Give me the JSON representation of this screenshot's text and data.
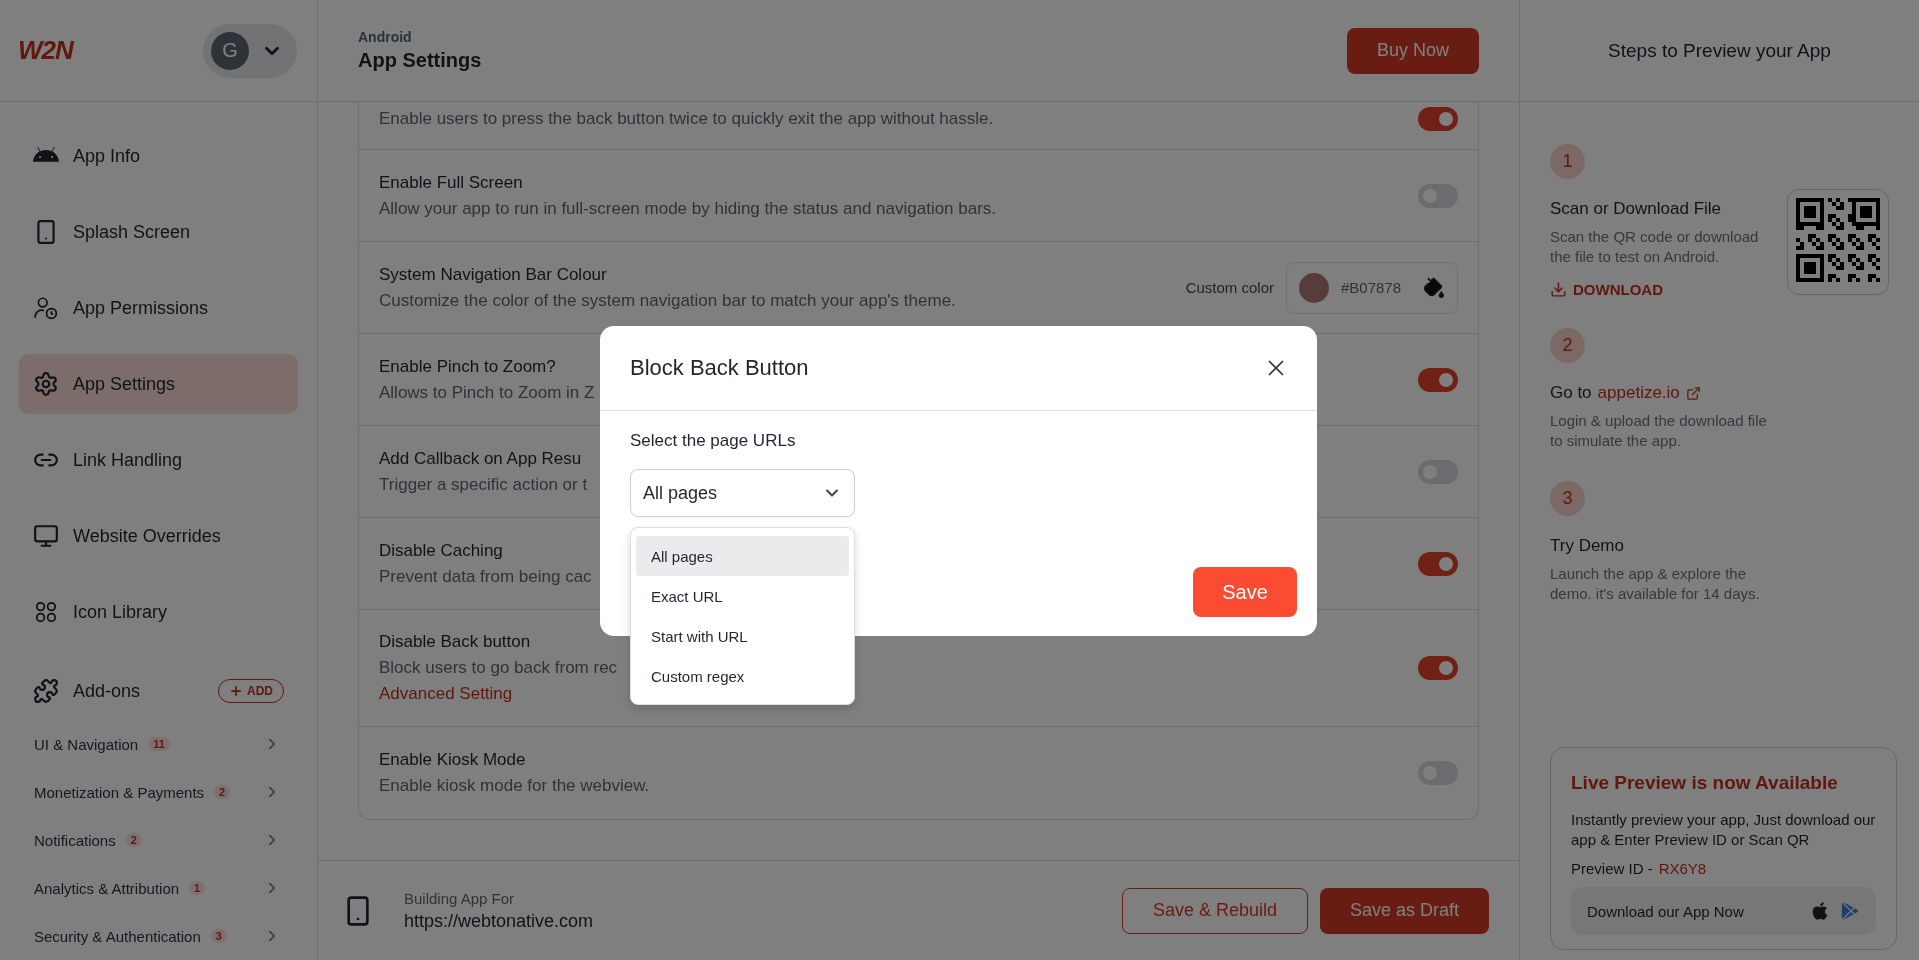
{
  "brand": {
    "logo": "W2N",
    "avatar": "G"
  },
  "sidebar": {
    "items": [
      {
        "label": "App Info",
        "selected": false
      },
      {
        "label": "Splash Screen",
        "selected": false
      },
      {
        "label": "App Permissions",
        "selected": false
      },
      {
        "label": "App Settings",
        "selected": true
      },
      {
        "label": "Link Handling",
        "selected": false
      },
      {
        "label": "Website Overrides",
        "selected": false
      },
      {
        "label": "Icon Library",
        "selected": false
      }
    ],
    "addons": {
      "label": "Add-ons",
      "button": "ADD"
    },
    "groups": [
      {
        "label": "UI & Navigation",
        "count": "11"
      },
      {
        "label": "Monetization & Payments",
        "count": "2"
      },
      {
        "label": "Notifications",
        "count": "2"
      },
      {
        "label": "Analytics & Attribution",
        "count": "1"
      },
      {
        "label": "Security & Authentication",
        "count": "3"
      }
    ]
  },
  "header": {
    "platform": "Android",
    "title": "App Settings",
    "button": "Buy Now"
  },
  "settings": [
    {
      "kind": "toggle",
      "description": "Enable users to press the back button twice to quickly exit the app without hassle.",
      "on": true
    },
    {
      "kind": "toggle",
      "title": "Enable Full Screen",
      "description": "Allow your app to run in full-screen mode by hiding the status and navigation bars.",
      "on": false
    },
    {
      "kind": "color",
      "title": "System Navigation Bar Colour",
      "description": "Customize the color of the system navigation bar to match your app's theme.",
      "color_label": "Custom color",
      "value": "#B07878"
    },
    {
      "kind": "toggle",
      "title": "Enable Pinch to Zoom?",
      "description": "Allows to Pinch to Zoom in Z",
      "on": true
    },
    {
      "kind": "toggle",
      "title": "Add Callback on App Resu",
      "description": "Trigger a specific action or t",
      "on": false
    },
    {
      "kind": "toggle",
      "title": "Disable Caching",
      "description": "Prevent data from being cac",
      "on": true
    },
    {
      "kind": "toggle",
      "title": "Disable Back button",
      "description": "Block users to go back from rec",
      "link": "Advanced Setting",
      "on": true
    },
    {
      "kind": "toggle",
      "title": "Enable Kiosk Mode",
      "description": "Enable kiosk mode for the webview.",
      "on": false
    }
  ],
  "footer": {
    "label": "Building App For",
    "url": "https://webtonative.com",
    "buttons": [
      "Save & Rebuild",
      "Save as Draft"
    ]
  },
  "preview": {
    "title": "Steps to Preview your App",
    "steps": [
      {
        "number": "1",
        "title": "Scan or Download File",
        "text": "Scan the QR code or download the file to test on Android.",
        "action": "DOWNLOAD"
      },
      {
        "number": "2",
        "title": "Go to",
        "link": "appetize.io",
        "text": "Login & upload the download file to simulate the app."
      },
      {
        "number": "3",
        "title": "Try Demo",
        "text": "Launch the app & explore the demo. it's available for 14 days."
      }
    ],
    "live": {
      "title": "Live Preview is now Available",
      "text": "Instantly preview your app, Just download our app & Enter Preview ID or Scan QR",
      "id_label": "Preview ID -",
      "id": "RX6Y8",
      "download": "Download our App Now"
    }
  },
  "modal": {
    "title": "Block Back Button",
    "label": "Select the page URLs",
    "value": "All pages",
    "save": "Save",
    "options": [
      {
        "label": "All pages",
        "selected": true
      },
      {
        "label": "Exact URL",
        "selected": false
      },
      {
        "label": "Start with URL",
        "selected": false
      },
      {
        "label": "Custom regex",
        "selected": false
      }
    ]
  }
}
